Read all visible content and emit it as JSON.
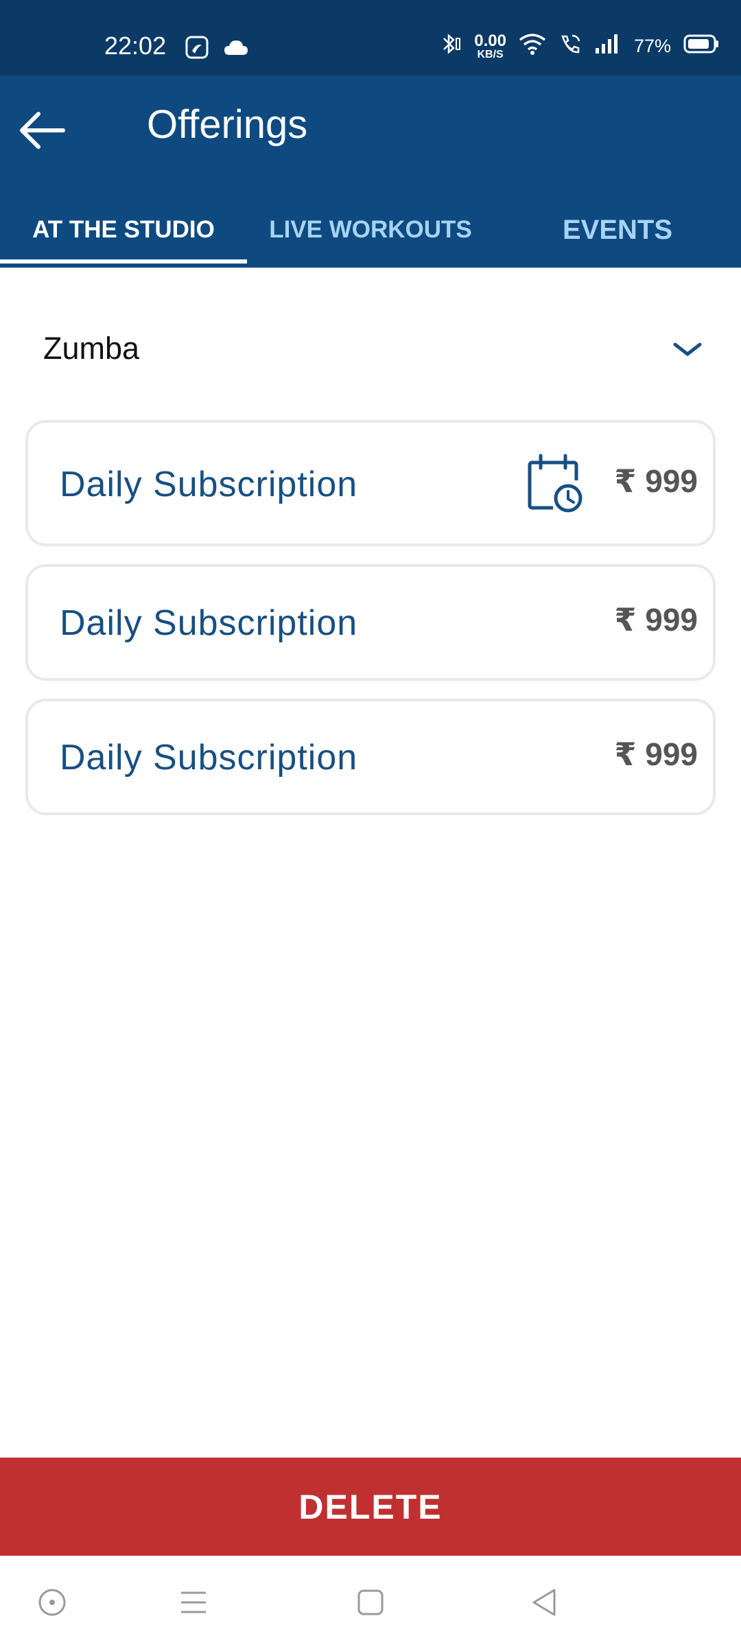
{
  "status_bar": {
    "time": "22:02",
    "net_speed_value": "0.00",
    "net_speed_unit": "KB/S",
    "battery": "77%",
    "icons": [
      "saavn-icon",
      "cloud-icon",
      "bluetooth-icon",
      "wifi-icon",
      "wifi-calling-icon",
      "signal-icon",
      "battery-icon"
    ]
  },
  "app_bar": {
    "title": "Offerings",
    "back_icon": "arrow-left-icon"
  },
  "tabs": [
    {
      "label": "AT THE STUDIO",
      "active": true
    },
    {
      "label": "LIVE WORKOUTS",
      "active": false
    },
    {
      "label": "EVENTS",
      "active": false
    }
  ],
  "category": {
    "selected": "Zumba",
    "icon": "chevron-down-icon"
  },
  "offerings": [
    {
      "name": "Daily Subscription",
      "price": "₹ 999",
      "icon": "calendar-clock-icon"
    },
    {
      "name": "Daily Subscription",
      "price": "₹ 999"
    },
    {
      "name": "Daily Subscription",
      "price": "₹ 999"
    }
  ],
  "delete_label": "DELETE",
  "colors": {
    "status_bar": "#0b3a66",
    "app_bar": "#0e4a80",
    "tab_inactive": "#a7d4f5",
    "card_text": "#174f82",
    "price_text": "#555555",
    "delete_bg": "#c03030"
  }
}
